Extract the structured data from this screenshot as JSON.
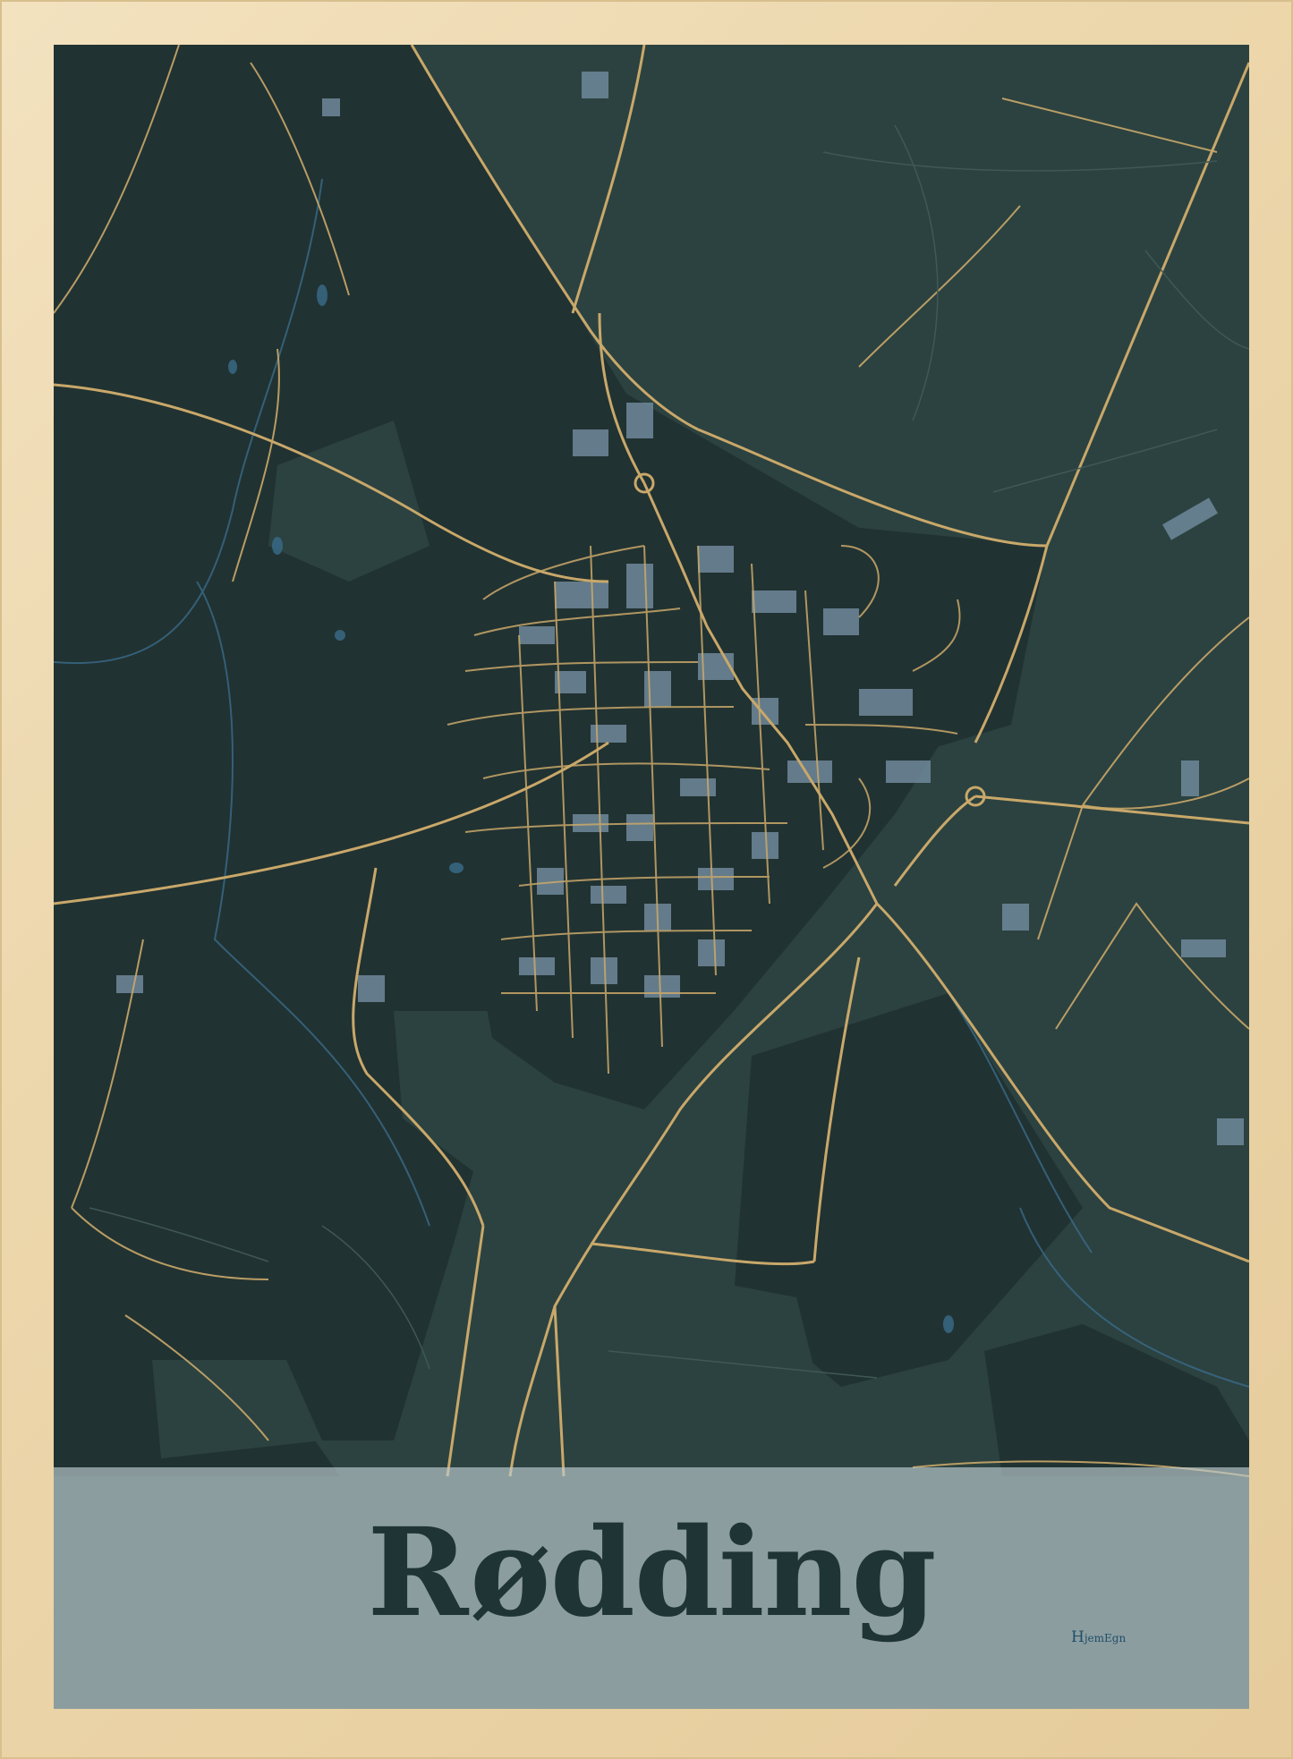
{
  "poster": {
    "city_name": "Rødding",
    "brand_initial": "H",
    "brand_rest": "jemEgn"
  },
  "colors": {
    "frame": "#ecd6ab",
    "land_dark": "#213232",
    "land_light": "#2c4240",
    "roads": "#c9a86a",
    "buildings": "#6f8a9c",
    "water": "#3a6b8a",
    "title_band": "#bccbce",
    "title_text": "#1f3434"
  }
}
